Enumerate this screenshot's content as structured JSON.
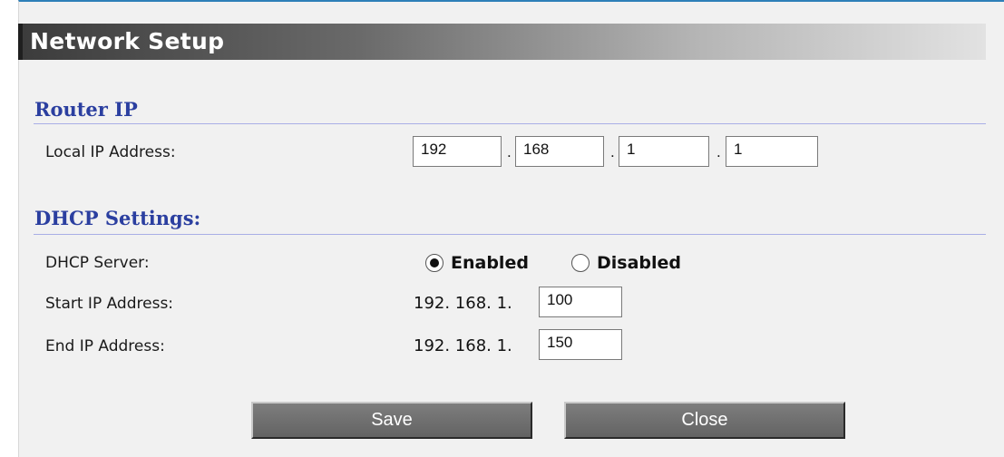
{
  "title": "Network Setup",
  "router_ip": {
    "section_label": "Router IP",
    "local_ip_label": "Local IP Address:",
    "octets": [
      "192",
      "168",
      "1",
      "1"
    ],
    "separator": "."
  },
  "dhcp": {
    "section_label": "DHCP Settings:",
    "server_label": "DHCP Server:",
    "enabled_label": "Enabled",
    "disabled_label": "Disabled",
    "selected": "Enabled",
    "start_label": "Start IP Address:",
    "start_prefix": "192. 168. 1.",
    "start_value": "100",
    "end_label": "End IP Address:",
    "end_prefix": "192. 168. 1.",
    "end_value": "150"
  },
  "buttons": {
    "save": "Save",
    "close": "Close"
  },
  "colors": {
    "section_title": "#2b3fa0",
    "accent_top": "#2e7fb8",
    "button_bg": "#6e6e6e"
  }
}
